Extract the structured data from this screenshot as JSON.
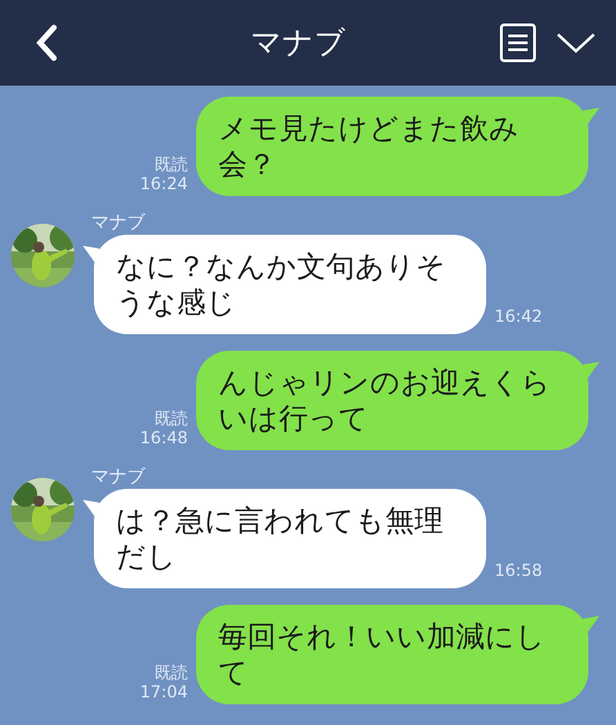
{
  "header": {
    "title": "マナブ"
  },
  "messages": [
    {
      "kind": "sent",
      "text": "メモ見たけどまた飲み会？",
      "read": "既読",
      "time": "16:24"
    },
    {
      "kind": "received",
      "sender": "マナブ",
      "text": "なに？なんか文句ありそうな感じ",
      "time": "16:42"
    },
    {
      "kind": "sent",
      "text": "んじゃリンのお迎えくらいは行って",
      "read": "既読",
      "time": "16:48"
    },
    {
      "kind": "received",
      "sender": "マナブ",
      "text": "は？急に言われても無理だし",
      "time": "16:58"
    },
    {
      "kind": "sent",
      "text": "毎回それ！いい加減にして",
      "read": "既読",
      "time": "17:04"
    }
  ]
}
